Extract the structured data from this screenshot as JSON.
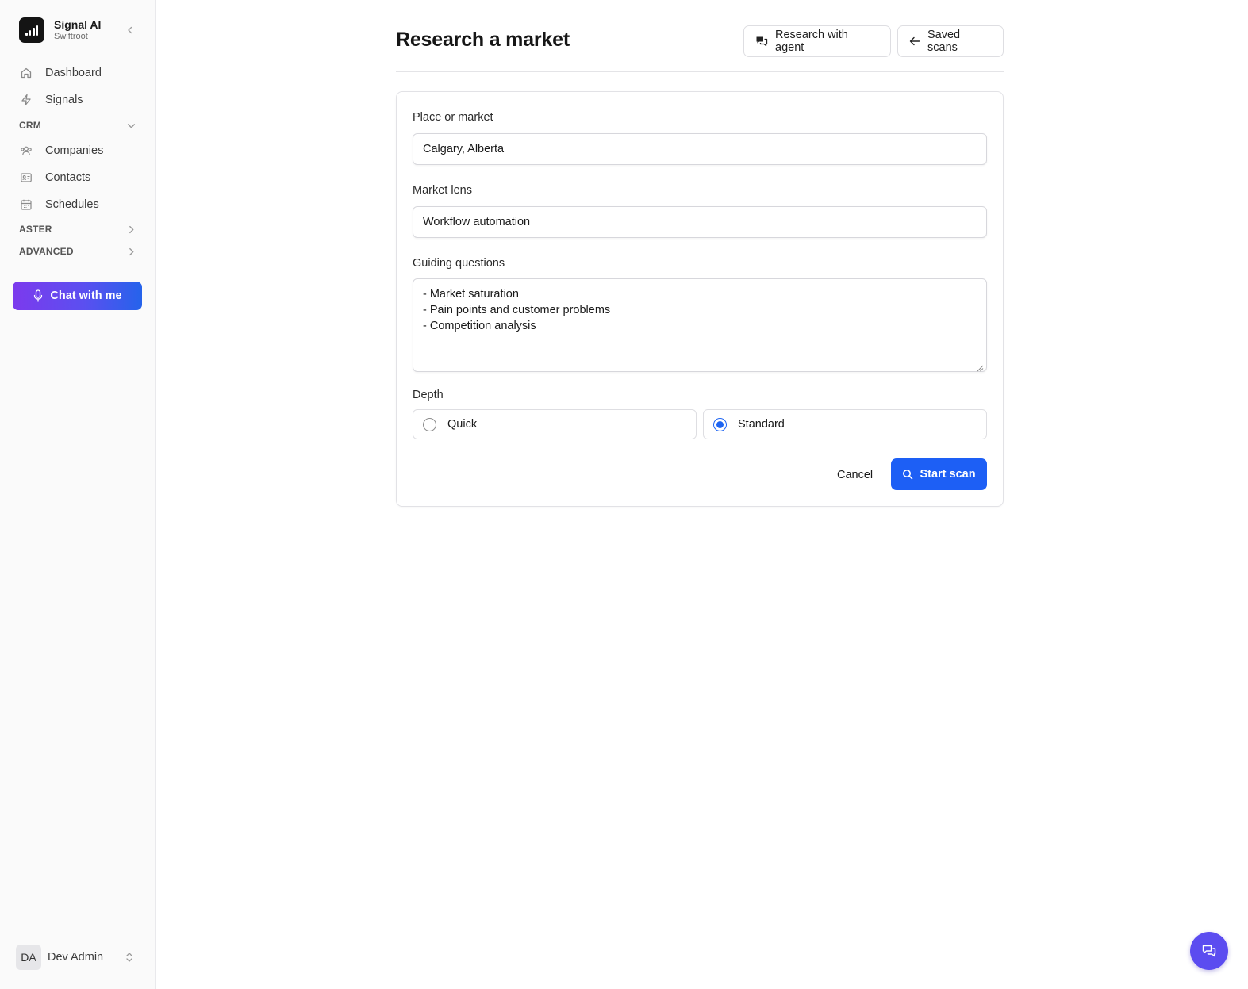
{
  "brand": {
    "name": "Signal AI",
    "org": "Swiftroot"
  },
  "sidebar": {
    "items": [
      {
        "label": "Dashboard",
        "icon": "home-icon"
      },
      {
        "label": "Signals",
        "icon": "bolt-icon"
      }
    ],
    "crm": {
      "heading": "CRM",
      "items": [
        {
          "label": "Companies",
          "icon": "users-icon"
        },
        {
          "label": "Contacts",
          "icon": "id-card-icon"
        },
        {
          "label": "Schedules",
          "icon": "calendar-icon"
        }
      ]
    },
    "aster": {
      "heading": "ASTER"
    },
    "advanced": {
      "heading": "ADVANCED"
    },
    "chat_button": "Chat with me",
    "user": {
      "initials": "DA",
      "name": "Dev Admin"
    }
  },
  "header": {
    "title": "Research a market",
    "research_button": "Research with agent",
    "saved_button": "Saved scans"
  },
  "form": {
    "place": {
      "label": "Place or market",
      "value": "Calgary, Alberta"
    },
    "lens": {
      "label": "Market lens",
      "value": "Workflow automation"
    },
    "questions": {
      "label": "Guiding questions",
      "lines": [
        "- Market saturation",
        "- Pain points and customer problems",
        "- Competition analysis"
      ]
    },
    "depth": {
      "label": "Depth",
      "options": [
        {
          "label": "Quick",
          "selected": false
        },
        {
          "label": "Standard",
          "selected": true
        }
      ]
    },
    "cancel": "Cancel",
    "submit": "Start scan"
  },
  "colors": {
    "primary": "#1d5ff5",
    "chat_gradient_start": "#7c3aed",
    "fab": "#5b4cf0"
  }
}
